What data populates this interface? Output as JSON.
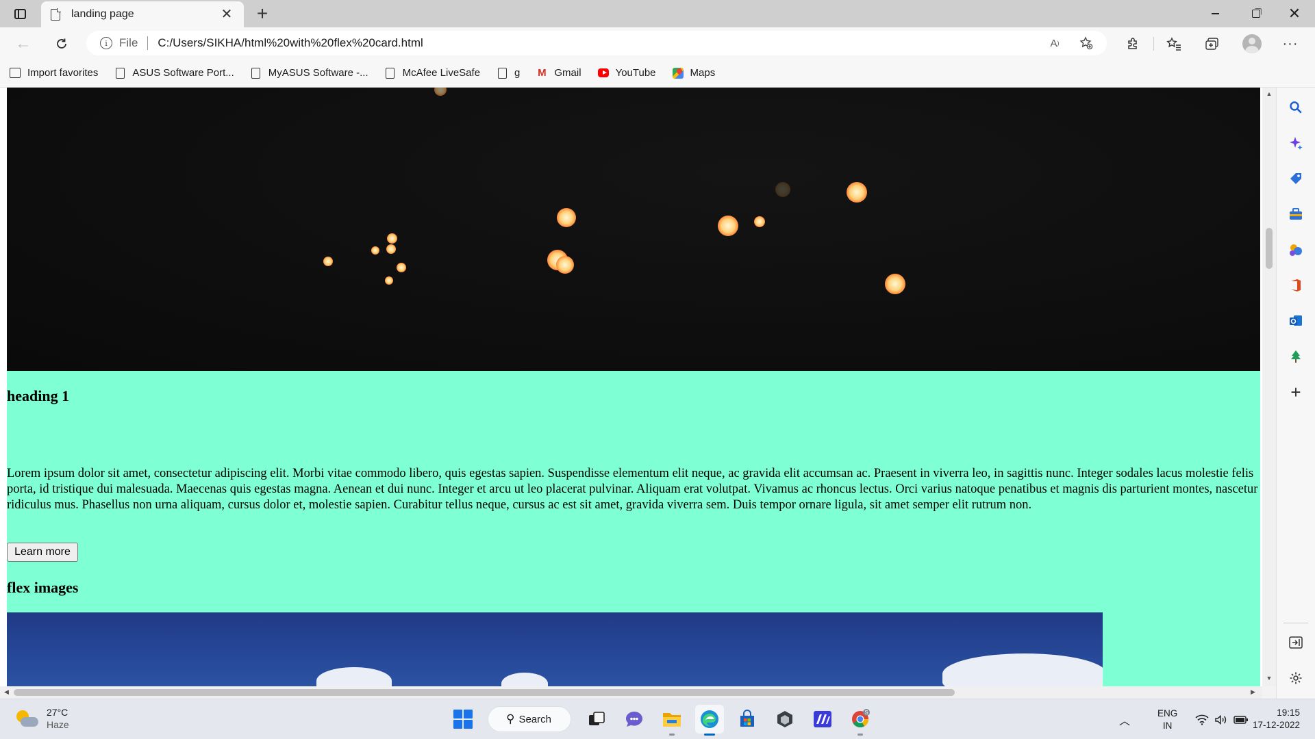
{
  "browser": {
    "tab": {
      "title": "landing page"
    },
    "address": {
      "scheme_label": "File",
      "url": "C:/Users/SIKHA/html%20with%20flex%20card.html"
    },
    "favorites": [
      {
        "label": "Import favorites",
        "icon": "import-icon"
      },
      {
        "label": "ASUS Software Port...",
        "icon": "page-icon"
      },
      {
        "label": "MyASUS Software -...",
        "icon": "page-icon"
      },
      {
        "label": "McAfee LiveSafe",
        "icon": "page-icon"
      },
      {
        "label": "g",
        "icon": "page-icon"
      },
      {
        "label": "Gmail",
        "icon": "gmail-icon"
      },
      {
        "label": "YouTube",
        "icon": "youtube-icon"
      },
      {
        "label": "Maps",
        "icon": "maps-icon"
      }
    ]
  },
  "page": {
    "background_color": "#7fffd4",
    "heading1": "heading 1",
    "paragraph": "Lorem ipsum dolor sit amet, consectetur adipiscing elit. Morbi vitae commodo libero, quis egestas sapien. Suspendisse elementum elit neque, ac gravida elit accumsan ac. Praesent in viverra leo, in sagittis nunc. Integer sodales lacus molestie felis porta, id tristique dui malesuada. Maecenas quis egestas magna. Aenean et dui nunc. Integer et arcu ut leo placerat pulvinar. Aliquam erat volutpat. Vivamus ac rhoncus lectus. Orci varius natoque penatibus et magnis dis parturient montes, nascetur ridiculus mus. Phasellus non urna aliquam, cursus dolor et, molestie sapien. Curabitur tellus neque, cursus ac est sit amet, gravida viverra sem. Duis tempor ornare ligula, sit amet semper elit rutrum non.",
    "learn_more": "Learn more",
    "heading2": "flex images"
  },
  "taskbar": {
    "weather": {
      "temp": "27°C",
      "condition": "Haze"
    },
    "search_label": "Search",
    "lang": {
      "line1": "ENG",
      "line2": "IN"
    },
    "clock": {
      "time": "19:15",
      "date": "17-12-2022"
    }
  }
}
